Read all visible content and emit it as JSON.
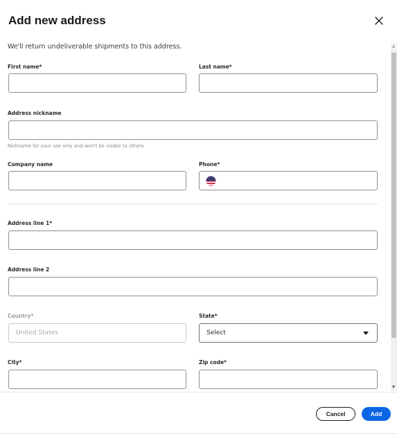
{
  "dialog": {
    "title": "Add new address",
    "close_icon": "close-icon"
  },
  "form": {
    "subtitle": "We'll return undeliverable shipments to this address.",
    "first_name": {
      "label": "First name*",
      "value": ""
    },
    "last_name": {
      "label": "Last name*",
      "value": ""
    },
    "nickname": {
      "label": "Address nickname",
      "value": "",
      "helper": "Nickname for your use only and won't be visible to others"
    },
    "company": {
      "label": "Company name",
      "value": ""
    },
    "phone": {
      "label": "Phone*",
      "value": "",
      "flag_icon": "us-flag-icon"
    },
    "address1": {
      "label": "Address line 1*",
      "value": ""
    },
    "address2": {
      "label": "Address line 2",
      "value": ""
    },
    "country": {
      "label": "Country*",
      "value": "United States",
      "disabled": true
    },
    "state": {
      "label": "State*",
      "selected": "Select"
    },
    "city": {
      "label": "City*",
      "value": ""
    },
    "zip": {
      "label": "Zip code*",
      "value": ""
    }
  },
  "footer": {
    "cancel_label": "Cancel",
    "add_label": "Add"
  },
  "colors": {
    "primary": "#0a66e4",
    "text": "#191919",
    "border": "#8f8f8f"
  }
}
